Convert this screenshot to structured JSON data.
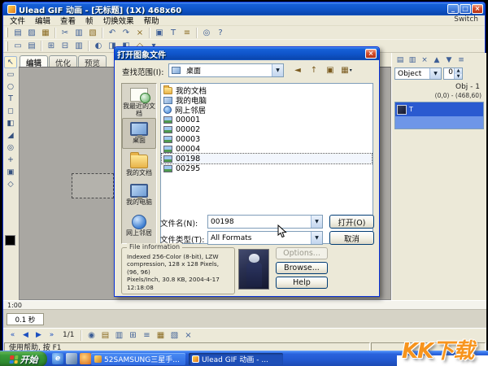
{
  "window": {
    "title": "Ulead GIF 动画 - [无标题] (1X) 468x60",
    "menu": [
      "文件",
      "编辑",
      "查看",
      "帧",
      "切换效果",
      "帮助"
    ],
    "switch_label": "Switch"
  },
  "icons": {
    "minimize": "_",
    "maximize": "□",
    "close": "×",
    "dropdown": "▼",
    "spin_up": "▲",
    "spin_down": "▼",
    "views_arrow": "▾"
  },
  "toolbar1": [
    {
      "name": "new",
      "glyph": "▤"
    },
    {
      "name": "open",
      "glyph": "▨"
    },
    {
      "name": "save",
      "glyph": "▦"
    },
    {
      "name": "cut",
      "glyph": "✂"
    },
    {
      "name": "copy",
      "glyph": "▥"
    },
    {
      "name": "paste",
      "glyph": "▧"
    },
    {
      "name": "undo",
      "glyph": "↶"
    },
    {
      "name": "redo",
      "glyph": "↷"
    },
    {
      "name": "delete",
      "glyph": "×"
    },
    {
      "name": "add-image",
      "glyph": "▣"
    },
    {
      "name": "add-text",
      "glyph": "T"
    },
    {
      "name": "add-banner",
      "glyph": "≡"
    },
    {
      "name": "zoom",
      "glyph": "◎"
    },
    {
      "name": "help",
      "glyph": "?"
    }
  ],
  "toolbar2": [
    {
      "name": "select-frame",
      "glyph": "▭"
    },
    {
      "name": "frame-properties",
      "glyph": "▤"
    },
    {
      "name": "add-frame",
      "glyph": "⊞"
    },
    {
      "name": "delete-frame",
      "glyph": "⊟"
    },
    {
      "name": "duplicate-frame",
      "glyph": "▥"
    },
    {
      "name": "tween",
      "glyph": "◐"
    },
    {
      "name": "banner",
      "glyph": "◨"
    },
    {
      "name": "transition",
      "glyph": "◧"
    },
    {
      "name": "resize",
      "glyph": "◇"
    },
    {
      "name": "more",
      "glyph": "▾"
    }
  ],
  "toolbox": [
    {
      "name": "select-tool",
      "glyph": "↖"
    },
    {
      "name": "marquee-tool",
      "glyph": "▭"
    },
    {
      "name": "lasso-tool",
      "glyph": "○"
    },
    {
      "name": "text-tool",
      "glyph": "T"
    },
    {
      "name": "eraser-tool",
      "glyph": "◻"
    },
    {
      "name": "fill-tool",
      "glyph": "◧"
    },
    {
      "name": "eyedropper-tool",
      "glyph": "◢"
    },
    {
      "name": "zoom-tool",
      "glyph": "◎"
    },
    {
      "name": "pan-tool",
      "glyph": "+"
    },
    {
      "name": "crop-tool",
      "glyph": "▣"
    },
    {
      "name": "shape-tool",
      "glyph": "◇"
    }
  ],
  "tabs": [
    "编辑",
    "优化",
    "预览"
  ],
  "right_panel": {
    "toolbar": [
      {
        "name": "object-new",
        "glyph": "▤"
      },
      {
        "name": "object-duplicate",
        "glyph": "▥"
      },
      {
        "name": "object-delete",
        "glyph": "×"
      },
      {
        "name": "object-up",
        "glyph": "▲"
      },
      {
        "name": "object-down",
        "glyph": "▼"
      },
      {
        "name": "object-properties",
        "glyph": "≡"
      }
    ],
    "object_combo": "Object",
    "spin_value": "0",
    "object_label": "Obj - 1",
    "coords": "(0,0) - (468,60)",
    "selected_glyph": "T"
  },
  "timeline": {
    "time": "1:00",
    "delay": "0.1 秒"
  },
  "playback": [
    {
      "name": "first-frame",
      "glyph": "«"
    },
    {
      "name": "prev-frame",
      "glyph": "◀"
    },
    {
      "name": "play",
      "glyph": "▶"
    },
    {
      "name": "last-frame",
      "glyph": "»"
    }
  ],
  "bottom_icons": [
    {
      "name": "loop",
      "glyph": "◉"
    },
    {
      "name": "export",
      "glyph": "▤"
    },
    {
      "name": "frame-panel",
      "glyph": "▥"
    },
    {
      "name": "grid",
      "glyph": "⊞"
    },
    {
      "name": "list-view",
      "glyph": "≡"
    },
    {
      "name": "palette",
      "glyph": "▦"
    },
    {
      "name": "settings",
      "glyph": "▧"
    },
    {
      "name": "trash",
      "glyph": "×"
    }
  ],
  "bottombar": {
    "counter": "1/1"
  },
  "statusbar": {
    "text": "使用帮助, 按 F1"
  },
  "dialog": {
    "title": "打开图象文件",
    "look_in_label": "查找范围(I):",
    "look_in_value": "桌面",
    "toolbar": [
      {
        "name": "back-folder",
        "glyph": "◄"
      },
      {
        "name": "up-one-level",
        "glyph": "↑"
      },
      {
        "name": "new-folder",
        "glyph": "▣"
      },
      {
        "name": "view-menu",
        "glyph": "▦"
      }
    ],
    "places": [
      "我最近的文档",
      "桌面",
      "我的文档",
      "我的电脑",
      "网上邻居"
    ],
    "files": [
      {
        "name": "我的文档",
        "type": "folder"
      },
      {
        "name": "我的电脑",
        "type": "computer"
      },
      {
        "name": "网上邻居",
        "type": "network"
      },
      {
        "name": "00001",
        "type": "image"
      },
      {
        "name": "00002",
        "type": "image"
      },
      {
        "name": "00003",
        "type": "image"
      },
      {
        "name": "00004",
        "type": "image"
      },
      {
        "name": "00198",
        "type": "image"
      },
      {
        "name": "00295",
        "type": "image"
      }
    ],
    "file_name_label": "文件名(N):",
    "file_name_value": "00198",
    "file_type_label": "文件类型(T):",
    "file_type_value": "All Formats",
    "open_button": "打开(O)",
    "cancel_button": "取消",
    "info_title": "File information",
    "info_lines": [
      "Indexed 256-Color (8-bit), LZW",
      "compression, 128 x 128 Pixels, (96, 96)",
      "Pixels/Inch, 30.8 KB, 2004-4-17",
      "12:18:08"
    ],
    "options_button": "Options...",
    "browse_button": "Browse...",
    "help_button": "Help"
  },
  "taskbar": {
    "start": "开始",
    "tasks": [
      "52SAMSUNG三星手...",
      "Ulead GIF 动画 - ..."
    ]
  },
  "watermark": "KK下载"
}
